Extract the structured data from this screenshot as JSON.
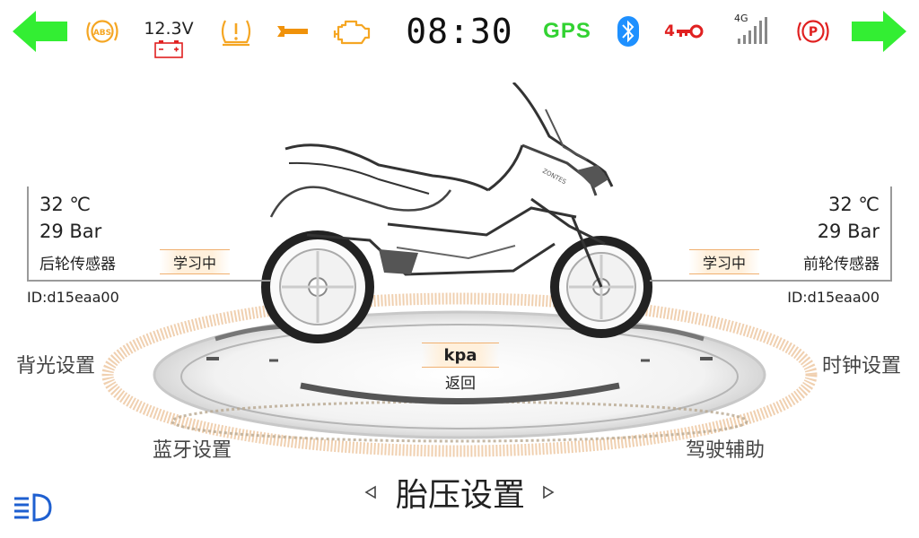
{
  "status_bar": {
    "voltage": "12.3V",
    "time": "08:30",
    "gps_label": "GPS",
    "key_count": "4",
    "signal_label": "4G",
    "icons": [
      "back-arrow",
      "abs",
      "battery",
      "tire-pressure-warning",
      "wrench",
      "engine",
      "gps",
      "bluetooth",
      "key",
      "signal",
      "parking-brake",
      "forward-arrow"
    ],
    "colors": {
      "arrow": "#33ee33",
      "warning": "#f5a623",
      "wrench": "#f0920a",
      "bluetooth": "#1e90ff",
      "alert": "#e02020",
      "gps": "#32d232"
    }
  },
  "rear_sensor": {
    "temperature": "32 ℃",
    "pressure": "29 Bar",
    "name": "后轮传感器",
    "status": "学习中",
    "id": "ID:d15eaa00"
  },
  "front_sensor": {
    "temperature": "32 ℃",
    "pressure": "29 Bar",
    "name": "前轮传感器",
    "status": "学习中",
    "id": "ID:d15eaa00"
  },
  "menu": {
    "backlight": "背光设置",
    "clock": "时钟设置",
    "bluetooth": "蓝牙设置",
    "driving_assist": "驾驶辅助",
    "unit": "kpa",
    "back": "返回"
  },
  "page_title": "胎压设置",
  "bike_brand": "ZONTES"
}
